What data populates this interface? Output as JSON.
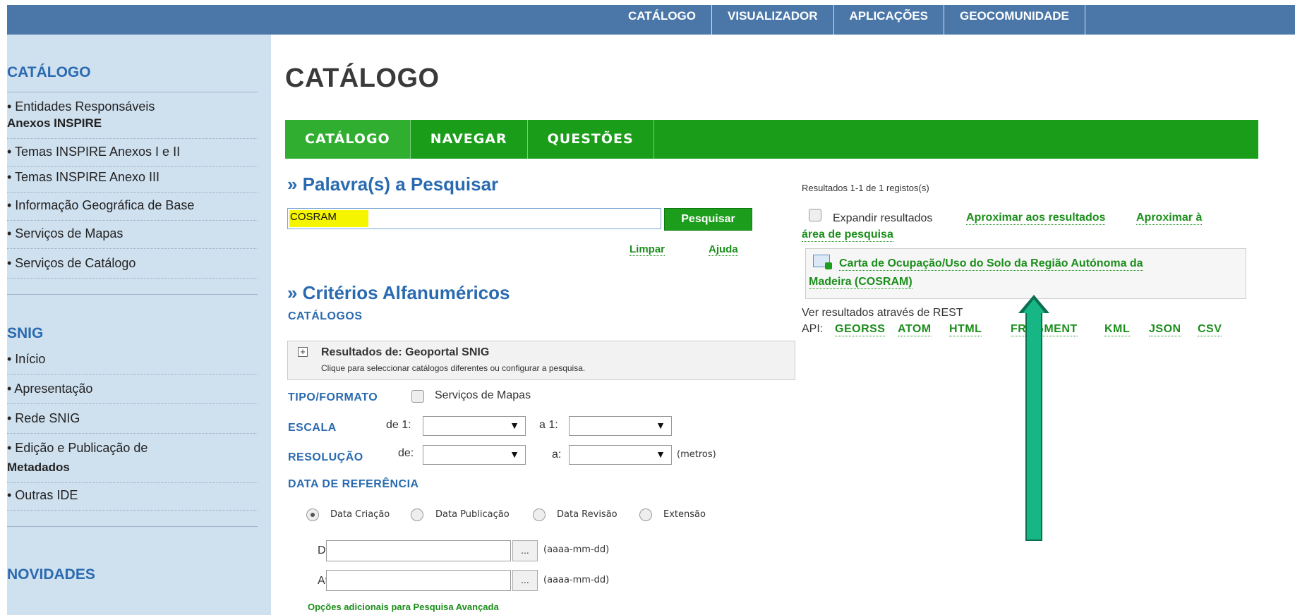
{
  "topnav": {
    "items": [
      "CATÁLOGO",
      "VISUALIZADOR",
      "APLICAÇÕES",
      "GEOCOMUNIDADE"
    ]
  },
  "sidebar": {
    "catalogo_heading": "CATÁLOGO",
    "catalogo_items": [
      "• Entidades Responsáveis",
      "Anexos INSPIRE",
      "• Temas INSPIRE Anexos I e II",
      "• Temas INSPIRE Anexo III",
      "• Informação Geográfica de Base",
      "• Serviços de Mapas",
      "• Serviços de Catálogo"
    ],
    "snig_heading": "SNIG",
    "snig_items": [
      "• Início",
      "• Apresentação",
      "• Rede SNIG",
      "• Edição e Publicação de",
      "Metadados",
      "• Outras IDE"
    ],
    "novidades_heading": "NOVIDADES"
  },
  "main": {
    "page_title": "CATÁLOGO",
    "tabs": [
      "CATÁLOGO",
      "NAVEGAR",
      "QUESTÕES"
    ],
    "search_heading": "» Palavra(s) a Pesquisar",
    "search_value": "COSRAM",
    "search_button": "Pesquisar",
    "clear_link": "Limpar",
    "help_link": "Ajuda",
    "criteria_heading": "» Critérios Alfanuméricos",
    "catalogos_label": "CATÁLOGOS",
    "catalog_box_title": "Resultados de: Geoportal SNIG",
    "catalog_box_hint": "Clique para seleccionar catálogos diferentes ou configurar a pesquisa.",
    "tipo_label": "TIPO/FORMATO",
    "tipo_option": "Serviços de Mapas",
    "escala_label": "ESCALA",
    "escala_from": "de 1:",
    "escala_to": "a 1:",
    "resolucao_label": "RESOLUÇÃO",
    "res_from": "de:",
    "res_to": "a:",
    "res_unit": "(metros)",
    "data_label": "DATA DE REFERÊNCIA",
    "date_options": [
      "Data Criação",
      "Data Publicação",
      "Data Revisão",
      "Extensão"
    ],
    "selected_date_option": "Data Criação",
    "de_label": "De:",
    "ate_label": "Até:",
    "date_button": "...",
    "date_format": "(aaaa-mm-dd)",
    "advanced_link": "Opções adicionais para Pesquisa Avançada"
  },
  "results": {
    "summary": "Resultados 1-1 de 1 registos(s)",
    "expand_label": "Expandir resultados",
    "zoom_results": "Aproximar aos resultados",
    "zoom_area_1": "Aproximar à",
    "zoom_area_2": "área de pesquisa",
    "result_title_1": "Carta de Ocupação/Uso do Solo da Região Autónoma da",
    "result_title_2": "Madeira (COSRAM)",
    "rest_line": "Ver resultados através de REST",
    "api_label": "API:",
    "api_links": [
      "GEORSS",
      "ATOM",
      "HTML",
      "FRAGMENT",
      "KML",
      "JSON",
      "CSV"
    ]
  },
  "colors": {
    "topbar": "#4a77a8",
    "sidebar": "#cfe0ef",
    "tabbar": "#1a9e1a",
    "heading_blue": "#2a6ab0",
    "link_green": "#1c8e1c",
    "arrow": "#16b784"
  }
}
